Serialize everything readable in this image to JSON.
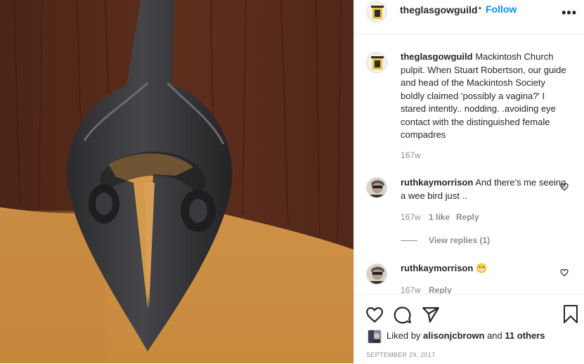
{
  "post": {
    "username": "theglasgowguild",
    "follow_label": "Follow",
    "separator": "•",
    "more_icon": "more-options-icon"
  },
  "caption": {
    "username": "theglasgowguild",
    "text": "Mackintosh Church pulpit. When Stuart Robertson, our guide and head of the Mackintosh Society boldly claimed 'possibly a vagina?' I stared intently.. nodding. .avoiding eye contact with the distinguished female compadres",
    "time": "167w"
  },
  "comments": [
    {
      "username": "ruthkaymorrison",
      "text": "And there's me seeing a wee bird just ..",
      "time": "167w",
      "likes": "1 like",
      "reply": "Reply",
      "view_replies": "View replies (1)"
    },
    {
      "username": "ruthkaymorrison",
      "text": "😁",
      "time": "167w",
      "reply": "Reply"
    }
  ],
  "likes": {
    "prefix": "Liked by",
    "user": "alisonjcbrown",
    "and": "and",
    "others": "11 others"
  },
  "date": "SEPTEMBER 29, 2017",
  "colors": {
    "link": "#0095f6",
    "muted": "#8e8e8e",
    "wood": "#5a2a1a",
    "glow": "#d79a48"
  }
}
